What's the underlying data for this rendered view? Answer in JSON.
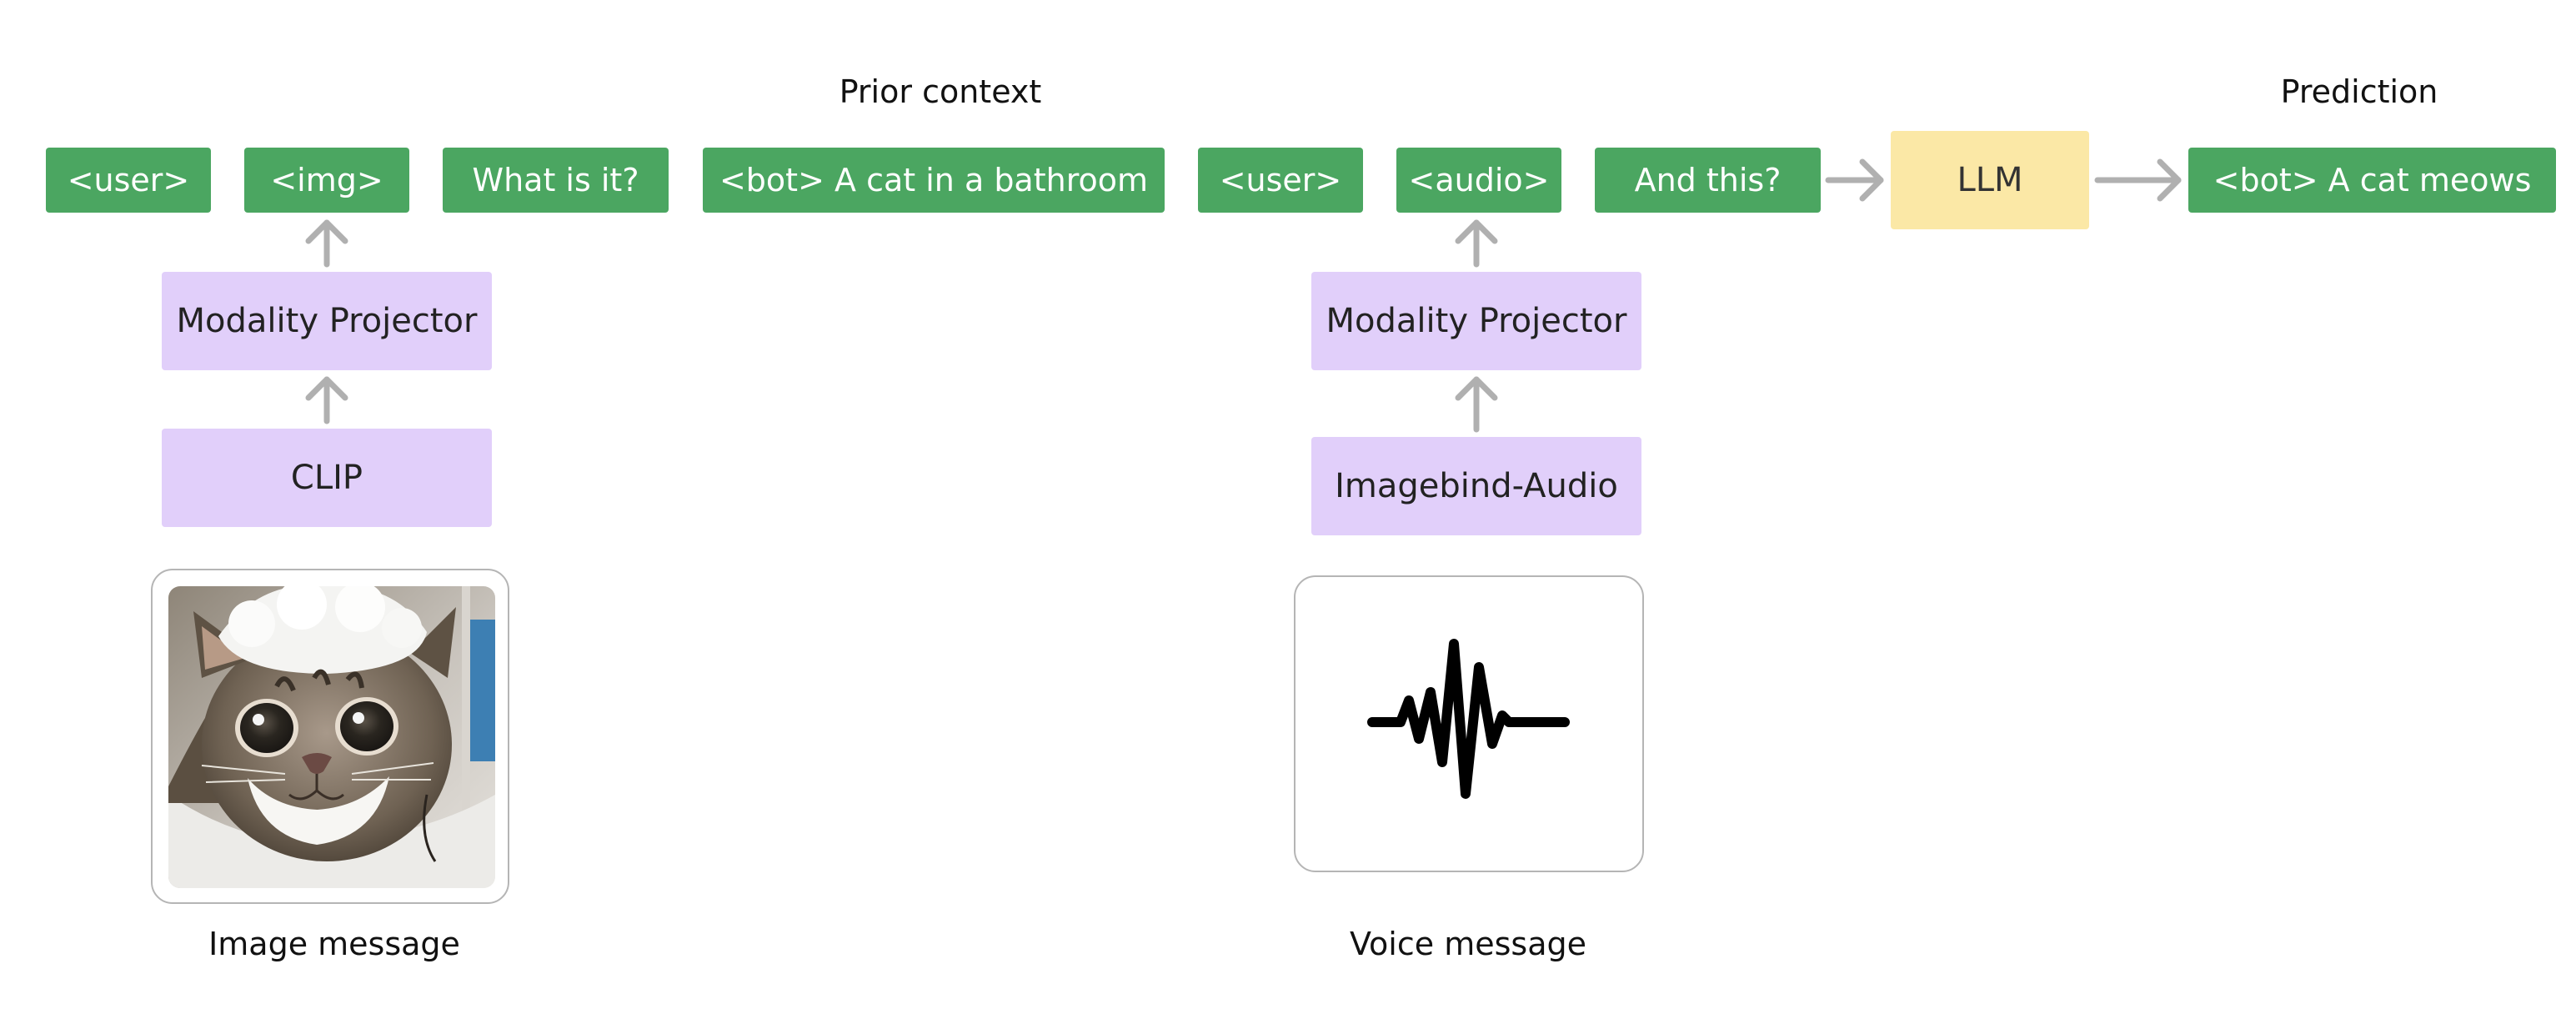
{
  "colors": {
    "token": "#4ba661",
    "projector": "#e1cffa",
    "llm": "#fbe8a6",
    "arrow": "#b0b0b0"
  },
  "headings": {
    "prior_context": "Prior context",
    "prediction": "Prediction"
  },
  "tokens": {
    "user_1": "<user>",
    "img": "<img>",
    "question_1": "What is it?",
    "bot_1": "<bot> A cat in a bathroom",
    "user_2": "<user>",
    "audio": "<audio>",
    "question_2": "And this?",
    "bot_prediction": "<bot> A cat meows"
  },
  "model": {
    "llm": "LLM"
  },
  "image_branch": {
    "projector": "Modality Projector",
    "encoder": "CLIP",
    "caption": "Image message",
    "picture": "cat-photo"
  },
  "audio_branch": {
    "projector": "Modality Projector",
    "encoder": "Imagebind-Audio",
    "caption": "Voice message",
    "icon": "waveform-icon"
  }
}
